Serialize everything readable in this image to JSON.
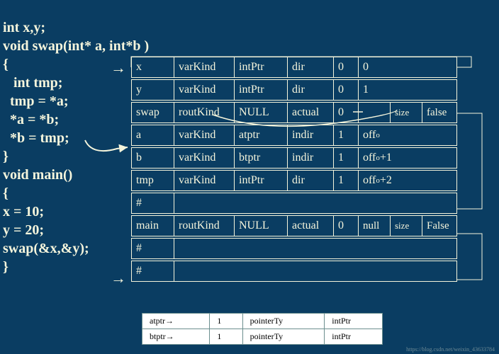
{
  "code": {
    "l1": "int x,y;",
    "l2": "void swap(int* a, int*b )",
    "l3": "{",
    "l4": "   int tmp;",
    "l5": "  tmp = *a;",
    "l6": "  *a = *b;",
    "l7": "  *b = tmp;",
    "l8": "}",
    "l9": "void main()",
    "l10": "{",
    "l11": "x = 10;",
    "l12": "y = 20;",
    "l13": "swap(&x,&y);",
    "l14": "}"
  },
  "table": {
    "rows": [
      {
        "c1": "x",
        "c2": "varKind",
        "c3": "intPtr",
        "c4": "dir",
        "c5": "0",
        "c6": "0"
      },
      {
        "c1": "y",
        "c2": "varKind",
        "c3": "intPtr",
        "c4": "dir",
        "c5": "0",
        "c6": "1"
      },
      {
        "c1": "swap",
        "c2": "routKind",
        "c3": "NULL",
        "c4": "actual",
        "c5": "0",
        "cs": "size",
        "ct": "false"
      },
      {
        "c1": "a",
        "c2": "varKind",
        "c3": "atptr",
        "c4": "indir",
        "c5": "1",
        "c6": "off",
        "sub": "o"
      },
      {
        "c1": "b",
        "c2": "varKind",
        "c3": "btptr",
        "c4": "indir",
        "c5": "1",
        "c6": "off",
        "sub": "o",
        "suffix": "+1"
      },
      {
        "c1": "tmp",
        "c2": "varKind",
        "c3": "intPtr",
        "c4": "dir",
        "c5": "1",
        "c6": "off",
        "sub": "o",
        "suffix": "+2"
      },
      {
        "c1": "#",
        "full": true
      },
      {
        "c1": "main",
        "c2": "routKind",
        "c3": "NULL",
        "c4": "actual",
        "c5": "0",
        "c6a": "null",
        "cs": "size",
        "ct": "False"
      },
      {
        "c1": "#",
        "full": true
      },
      {
        "c1": "#",
        "full": true
      }
    ]
  },
  "small_table": {
    "r1": {
      "c1": "atptr→",
      "c2": "1",
      "c3": "pointerTy",
      "c4": "intPtr"
    },
    "r2": {
      "c1": "btptr→",
      "c2": "1",
      "c3": "pointerTy",
      "c4": "intPtr"
    }
  },
  "watermark": "https://blog.csdn.net/weixin_43633784"
}
